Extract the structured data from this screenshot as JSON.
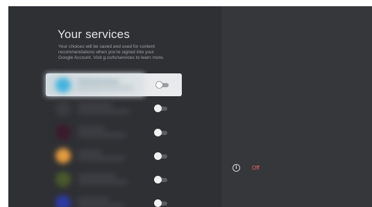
{
  "page": {
    "title": "Your services",
    "description": "Your choices will be saved and used for content recommendations when you're signed into your Google Account. Visit g.co/tv/services to learn more."
  },
  "services": [
    {
      "icon_color": "#46b4de",
      "focused": true,
      "toggle_on": false
    },
    {
      "icon_color": "#3a3c41",
      "focused": false,
      "toggle_on": false
    },
    {
      "icon_color": "#3b1a2c",
      "focused": false,
      "toggle_on": false
    },
    {
      "icon_color": "#e39b3c",
      "focused": false,
      "toggle_on": false
    },
    {
      "icon_color": "#4a5a2c",
      "focused": false,
      "toggle_on": false
    },
    {
      "icon_color": "#2b3aa6",
      "focused": false,
      "toggle_on": false
    }
  ],
  "detail": {
    "icon": "info-icon",
    "status": "Off",
    "status_color": "#ef6a6a"
  }
}
